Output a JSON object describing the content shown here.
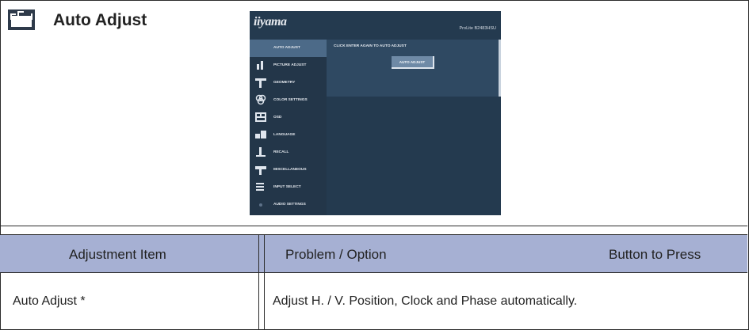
{
  "section": {
    "title": "Auto Adjust",
    "icon": "auto-adjust-icon"
  },
  "osd": {
    "logo": "iiyama",
    "model": "ProLite B2483HSU",
    "menu_items": [
      {
        "label": "AUTO ADJUST",
        "icon": "auto-adjust-icon",
        "active": true
      },
      {
        "label": "PICTURE ADJUST",
        "icon": "picture-adjust-icon",
        "active": false
      },
      {
        "label": "GEOMETRY",
        "icon": "geometry-icon",
        "active": false
      },
      {
        "label": "COLOR SETTINGS",
        "icon": "color-settings-icon",
        "active": false
      },
      {
        "label": "OSD",
        "icon": "osd-icon",
        "active": false
      },
      {
        "label": "LANGUAGE",
        "icon": "language-icon",
        "active": false
      },
      {
        "label": "RECALL",
        "icon": "recall-icon",
        "active": false
      },
      {
        "label": "MISCELLANEOUS",
        "icon": "miscellaneous-icon",
        "active": false
      },
      {
        "label": "INPUT SELECT",
        "icon": "input-select-icon",
        "active": false
      },
      {
        "label": "AUDIO SETTINGS",
        "icon": "audio-settings-icon",
        "active": false
      }
    ],
    "instruction": "CLICK ENTER AGAIN TO AUTO ADJUST",
    "button_label": "AUTO ADJUST"
  },
  "table": {
    "headers": {
      "item": "Adjustment Item",
      "problem": "Problem / Option",
      "button": "Button to Press"
    },
    "rows": [
      {
        "item": "Auto Adjust *",
        "problem": "Adjust H. / V. Position, Clock and Phase automatically."
      }
    ]
  },
  "colors": {
    "header_bg": "#a6b0d3",
    "osd_bg": "#243a4f",
    "osd_active": "#4c6a88"
  }
}
